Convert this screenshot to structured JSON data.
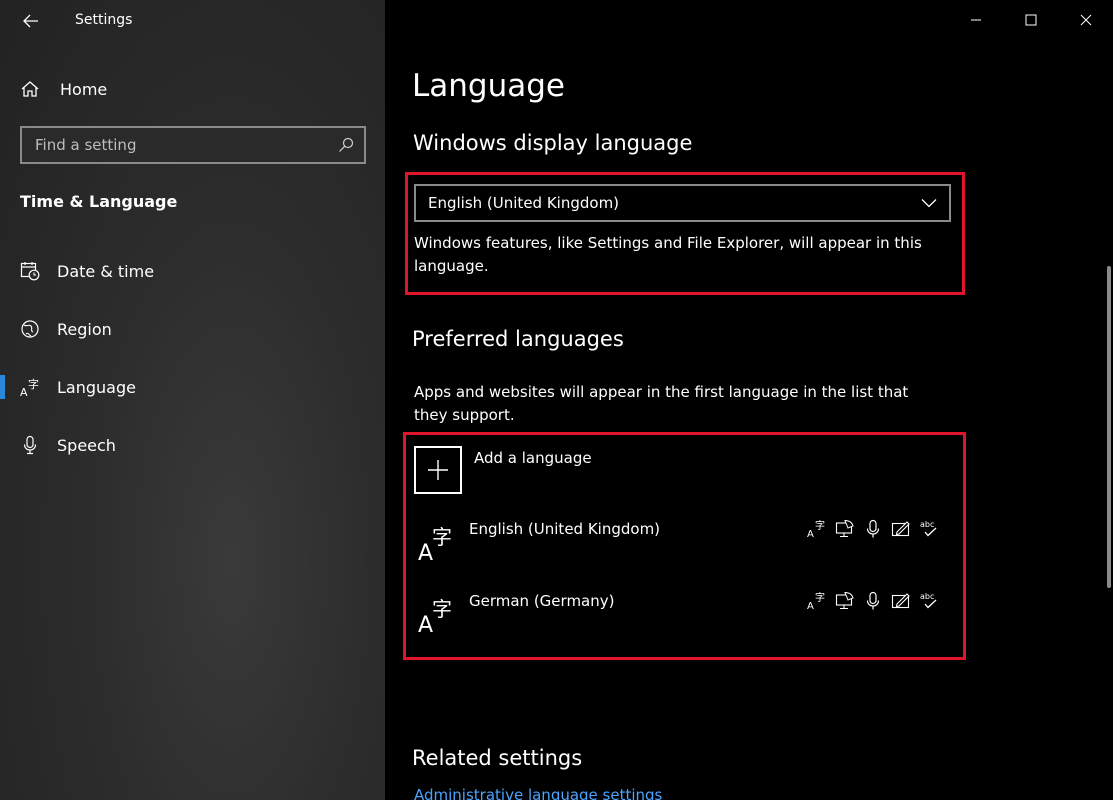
{
  "app": {
    "title": "Settings"
  },
  "sidebar": {
    "home_label": "Home",
    "search_placeholder": "Find a setting",
    "section_heading": "Time & Language",
    "items": [
      {
        "label": "Date & time",
        "icon": "calendar-clock-icon",
        "active": false
      },
      {
        "label": "Region",
        "icon": "globe-icon",
        "active": false
      },
      {
        "label": "Language",
        "icon": "language-icon",
        "active": true
      },
      {
        "label": "Speech",
        "icon": "microphone-icon",
        "active": false
      }
    ]
  },
  "main": {
    "title": "Language",
    "display_language": {
      "heading": "Windows display language",
      "selected": "English (United Kingdom)",
      "description": "Windows features, like Settings and File Explorer, will appear in this language."
    },
    "preferred": {
      "heading": "Preferred languages",
      "description": "Apps and websites will appear in the first language in the list that they support.",
      "add_label": "Add a language",
      "languages": [
        {
          "name": "English (United Kingdom)"
        },
        {
          "name": "German (Germany)"
        }
      ],
      "feature_icons": [
        "display-language-icon",
        "text-to-speech-icon",
        "speech-recognition-icon",
        "handwriting-icon",
        "spell-check-icon"
      ],
      "spell_label": "abc"
    },
    "related": {
      "heading": "Related settings",
      "link": "Administrative language settings"
    }
  },
  "colors": {
    "accent": "#2b88d8",
    "highlight": "#e0142a",
    "link": "#4aa3ff"
  }
}
